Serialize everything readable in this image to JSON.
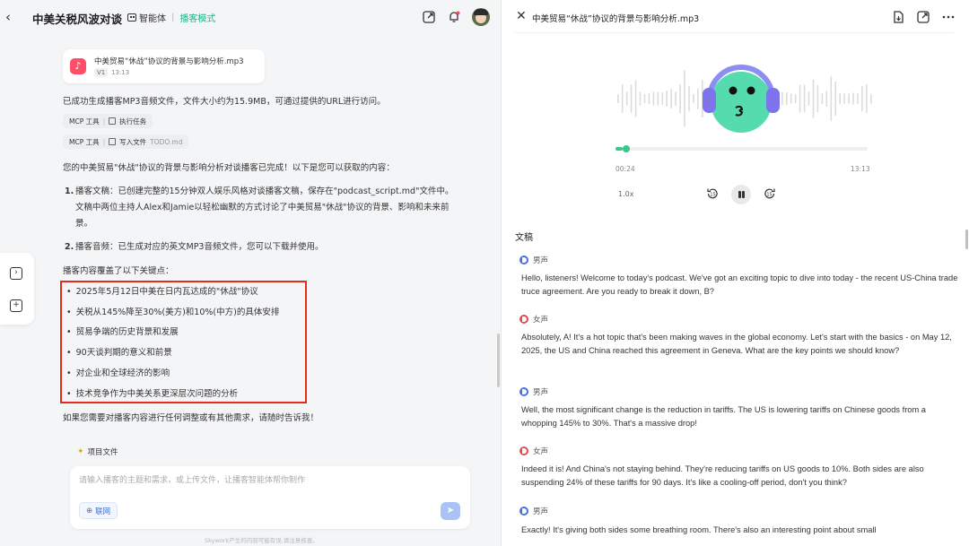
{
  "header": {
    "back_label": "‹",
    "title": "中美关税风波对谈",
    "agent_name": "智能体",
    "mode": "播客模式"
  },
  "file_card": {
    "name": "中美贸易“休战”协议的背景与影响分析.mp3",
    "version": "V1",
    "time": "13:13"
  },
  "messages": {
    "generated": "已成功生成播客MP3音频文件，文件大小约为15.9MB，可通过提供的URL进行访问。",
    "tool1": {
      "tag": "MCP 工具",
      "action": "执行任务"
    },
    "tool2": {
      "tag": "MCP 工具",
      "action": "写入文件",
      "file": "TODO.md"
    },
    "done": "您的中美贸易\"休战\"协议的背景与影响分析对谈播客已完成！以下是您可以获取的内容：",
    "item1_num": "1.",
    "item1_line1": "播客文稿：已创建完整的15分钟双人娱乐风格对谈播客文稿，保存在\"podcast_script.md\"文件中。",
    "item1_line2": "文稿中两位主持人Alex和Jamie以轻松幽默的方式讨论了中美贸易\"休战\"协议的背景、影响和未来前",
    "item1_line3": "景。",
    "item2_num": "2.",
    "item2_text": "播客音频：已生成对应的英文MP3音频文件，您可以下载并使用。",
    "covers": "播客内容覆盖了以下关键点：",
    "key_points": [
      "2025年5月12日中美在日内瓦达成的\"休战\"协议",
      "关税从145%降至30%(美方)和10%(中方)的具体安排",
      "贸易争端的历史背景和发展",
      "90天谈判期的意义和前景",
      "对企业和全球经济的影响",
      "技术竞争作为中美关系更深层次问题的分析"
    ],
    "closing": "如果您需要对播客内容进行任何调整或有其他需求，请随时告诉我！"
  },
  "composer": {
    "project_file_label": "项目文件",
    "placeholder": "请输入播客的主题和需求，或上传文件，让播客智能体帮你制作",
    "net_label": "联网",
    "disclaimer": "Skywork产生的内容可能有误,请注意核查。"
  },
  "player": {
    "title": "中美贸易“休战”协议的背景与影响分析.mp3",
    "current_time": "00:24",
    "total_time": "13:13",
    "progress": 0.03,
    "speed": "1.0x",
    "skip_back_label": "15",
    "skip_fwd_label": "15"
  },
  "transcript": {
    "heading": "文稿",
    "entries": [
      {
        "speaker": "男声",
        "gender": "male",
        "text": "Hello, listeners! Welcome to today's podcast. We've got an exciting topic to dive into today - the recent US-China trade truce agreement. Are you ready to break it down, B?"
      },
      {
        "speaker": "女声",
        "gender": "female",
        "text": "Absolutely, A! It's a hot topic that's been making waves in the global economy. Let's start with the basics - on May 12, 2025, the US and China reached this agreement in Geneva. What are the key points we should know?"
      },
      {
        "speaker": "男声",
        "gender": "male",
        "text": "Well, the most significant change is the reduction in tariffs. The US is lowering tariffs on Chinese goods from a whopping 145% to 30%. That's a massive drop!"
      },
      {
        "speaker": "女声",
        "gender": "female",
        "text": "Indeed it is! And China's not staying behind. They're reducing tariffs on US goods to 10%. Both sides are also suspending 24% of these tariffs for 90 days. It's like a cooling-off period, don't you think?"
      },
      {
        "speaker": "男声",
        "gender": "male",
        "text": "Exactly! It's giving both sides some breathing room. There's also an interesting point about small"
      }
    ]
  },
  "colors": {
    "accent_green": "#36c98a",
    "mode_green": "#1cb68a",
    "highlight_red": "#e8291c",
    "male_blue": "#4670e6",
    "female_red": "#e54b4b"
  }
}
